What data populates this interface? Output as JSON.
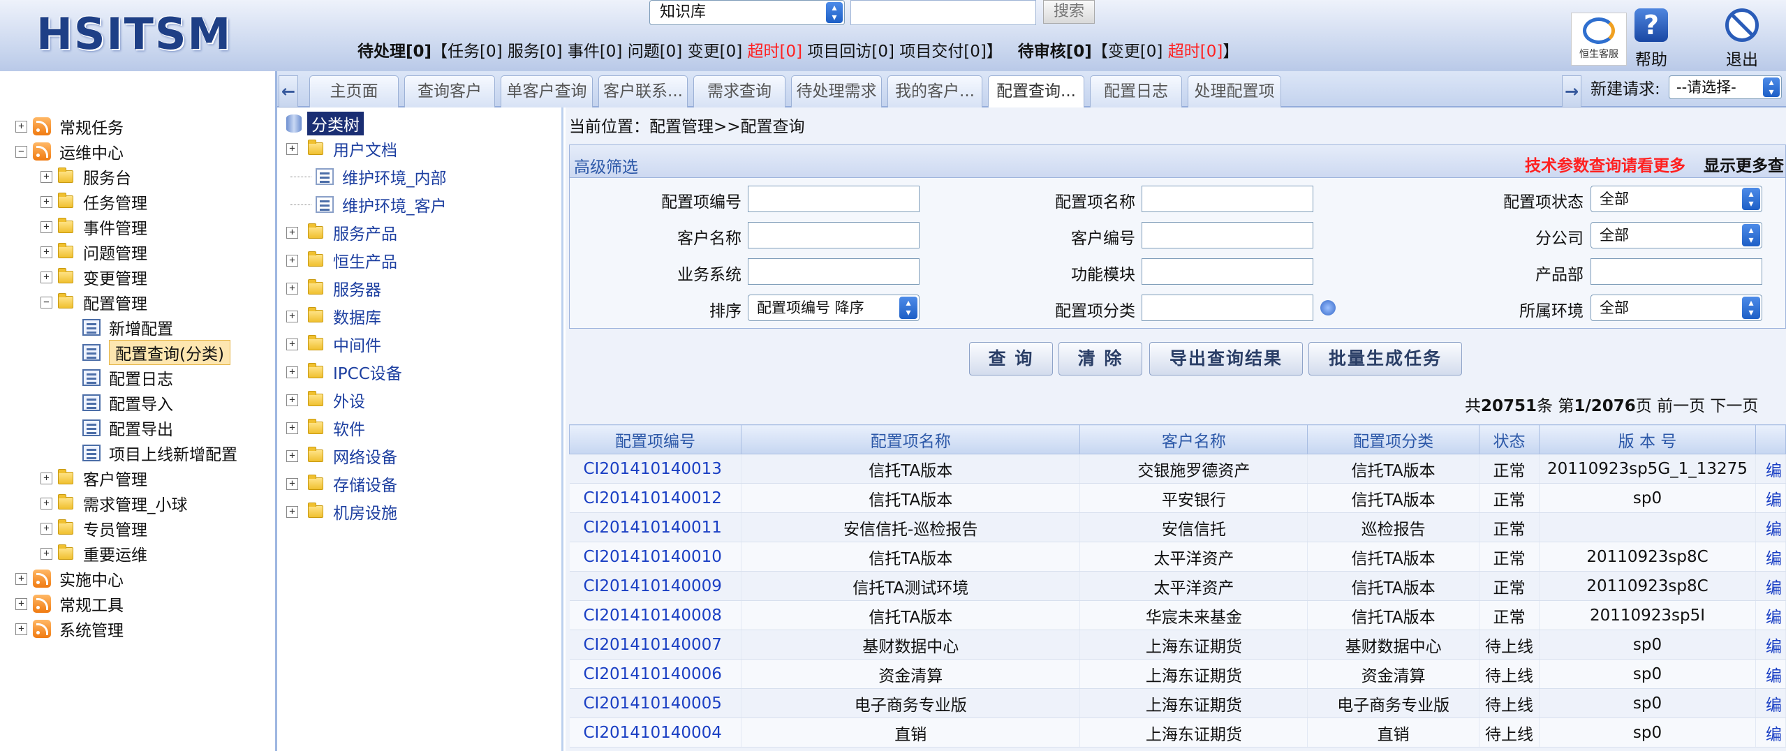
{
  "header": {
    "logo": "HSITSM",
    "kb_select": "知识库",
    "search_button": "搜索",
    "status": {
      "pending_label": "待处理",
      "pending_count": "[0]",
      "pending_detail_prefix": "【任务[0] 服务[0] 事件[0] 问题[0] 变更[0] ",
      "pending_overdue": "超时[0]",
      "pending_detail_suffix": " 项目回访[0] 项目交付[0]】",
      "review_label": "待审核",
      "review_count": "[0]",
      "review_detail_prefix": "【变更[0] ",
      "review_overdue": "超时[0]",
      "review_detail_suffix": "】"
    },
    "hs_logo_text": "恒生客服",
    "help": "帮助",
    "logout": "退出"
  },
  "sidebar": {
    "items": [
      {
        "label": "常规任务"
      },
      {
        "label": "运维中心"
      },
      {
        "label": "服务台"
      },
      {
        "label": "任务管理"
      },
      {
        "label": "事件管理"
      },
      {
        "label": "问题管理"
      },
      {
        "label": "变更管理"
      },
      {
        "label": "配置管理"
      },
      {
        "label": "新增配置"
      },
      {
        "label": "配置查询(分类)"
      },
      {
        "label": "配置日志"
      },
      {
        "label": "配置导入"
      },
      {
        "label": "配置导出"
      },
      {
        "label": "项目上线新增配置"
      },
      {
        "label": "客户管理"
      },
      {
        "label": "需求管理_小球"
      },
      {
        "label": "专员管理"
      },
      {
        "label": "重要运维"
      },
      {
        "label": "实施中心"
      },
      {
        "label": "常规工具"
      },
      {
        "label": "系统管理"
      }
    ]
  },
  "tabs": [
    {
      "label": "主页面"
    },
    {
      "label": "查询客户"
    },
    {
      "label": "单客户查询"
    },
    {
      "label": "客户联系..."
    },
    {
      "label": "需求查询"
    },
    {
      "label": "待处理需求"
    },
    {
      "label": "我的客户..."
    },
    {
      "label": "配置查询..."
    },
    {
      "label": "配置日志"
    },
    {
      "label": "处理配置项"
    }
  ],
  "new_request": {
    "label": "新建请求:",
    "value": "--请选择-"
  },
  "category_tree": {
    "root": "分类树",
    "items": [
      {
        "label": "用户文档"
      },
      {
        "label": "维护环境_内部"
      },
      {
        "label": "维护环境_客户"
      },
      {
        "label": "服务产品"
      },
      {
        "label": "恒生产品"
      },
      {
        "label": "服务器"
      },
      {
        "label": "数据库"
      },
      {
        "label": "中间件"
      },
      {
        "label": "IPCC设备"
      },
      {
        "label": "外设"
      },
      {
        "label": "软件"
      },
      {
        "label": "网络设备"
      },
      {
        "label": "存储设备"
      },
      {
        "label": "机房设施"
      }
    ]
  },
  "breadcrumb": "当前位置：配置管理>>配置查询",
  "filter": {
    "title": "高级筛选",
    "hint": "技术参数查询请看更多",
    "more": "显示更多查",
    "labels": {
      "ci_no": "配置项编号",
      "ci_name": "配置项名称",
      "ci_status": "配置项状态",
      "customer_name": "客户名称",
      "customer_no": "客户编号",
      "branch": "分公司",
      "business_system": "业务系统",
      "function_module": "功能模块",
      "product_dept": "产品部",
      "sort": "排序",
      "ci_category": "配置项分类",
      "environment": "所属环境"
    },
    "values": {
      "ci_status": "全部",
      "branch": "全部",
      "sort": "配置项编号 降序",
      "environment": "全部"
    }
  },
  "buttons": {
    "query": "查 询",
    "clear": "清 除",
    "export": "导出查询结果",
    "batch": "批量生成任务"
  },
  "pager": {
    "p1": "共",
    "total": "20751",
    "p2": "条 第",
    "page": "1/2076",
    "p3": "页 前一页 下一页"
  },
  "table": {
    "headers": [
      "配置项编号",
      "配置项名称",
      "客户名称",
      "配置项分类",
      "状态",
      "版 本 号",
      ""
    ],
    "rows": [
      [
        "CI201410140013",
        "信托TA版本",
        "交银施罗德资产",
        "信托TA版本",
        "正常",
        "20110923sp5G_1_13275",
        "编"
      ],
      [
        "CI201410140012",
        "信托TA版本",
        "平安银行",
        "信托TA版本",
        "正常",
        "sp0",
        "编"
      ],
      [
        "CI201410140011",
        "安信信托-巡检报告",
        "安信信托",
        "巡检报告",
        "正常",
        "",
        "编"
      ],
      [
        "CI201410140010",
        "信托TA版本",
        "太平洋资产",
        "信托TA版本",
        "正常",
        "20110923sp8C",
        "编"
      ],
      [
        "CI201410140009",
        "信托TA测试环境",
        "太平洋资产",
        "信托TA版本",
        "正常",
        "20110923sp8C",
        "编"
      ],
      [
        "CI201410140008",
        "信托TA版本",
        "华宸未来基金",
        "信托TA版本",
        "正常",
        "20110923sp5I",
        "编"
      ],
      [
        "CI201410140007",
        "基财数据中心",
        "上海东证期货",
        "基财数据中心",
        "待上线",
        "sp0",
        "编"
      ],
      [
        "CI201410140006",
        "资金清算",
        "上海东证期货",
        "资金清算",
        "待上线",
        "sp0",
        "编"
      ],
      [
        "CI201410140005",
        "电子商务专业版",
        "上海东证期货",
        "电子商务专业版",
        "待上线",
        "sp0",
        "编"
      ],
      [
        "CI201410140004",
        "直销",
        "上海东证期货",
        "直销",
        "待上线",
        "sp0",
        "编"
      ]
    ]
  }
}
